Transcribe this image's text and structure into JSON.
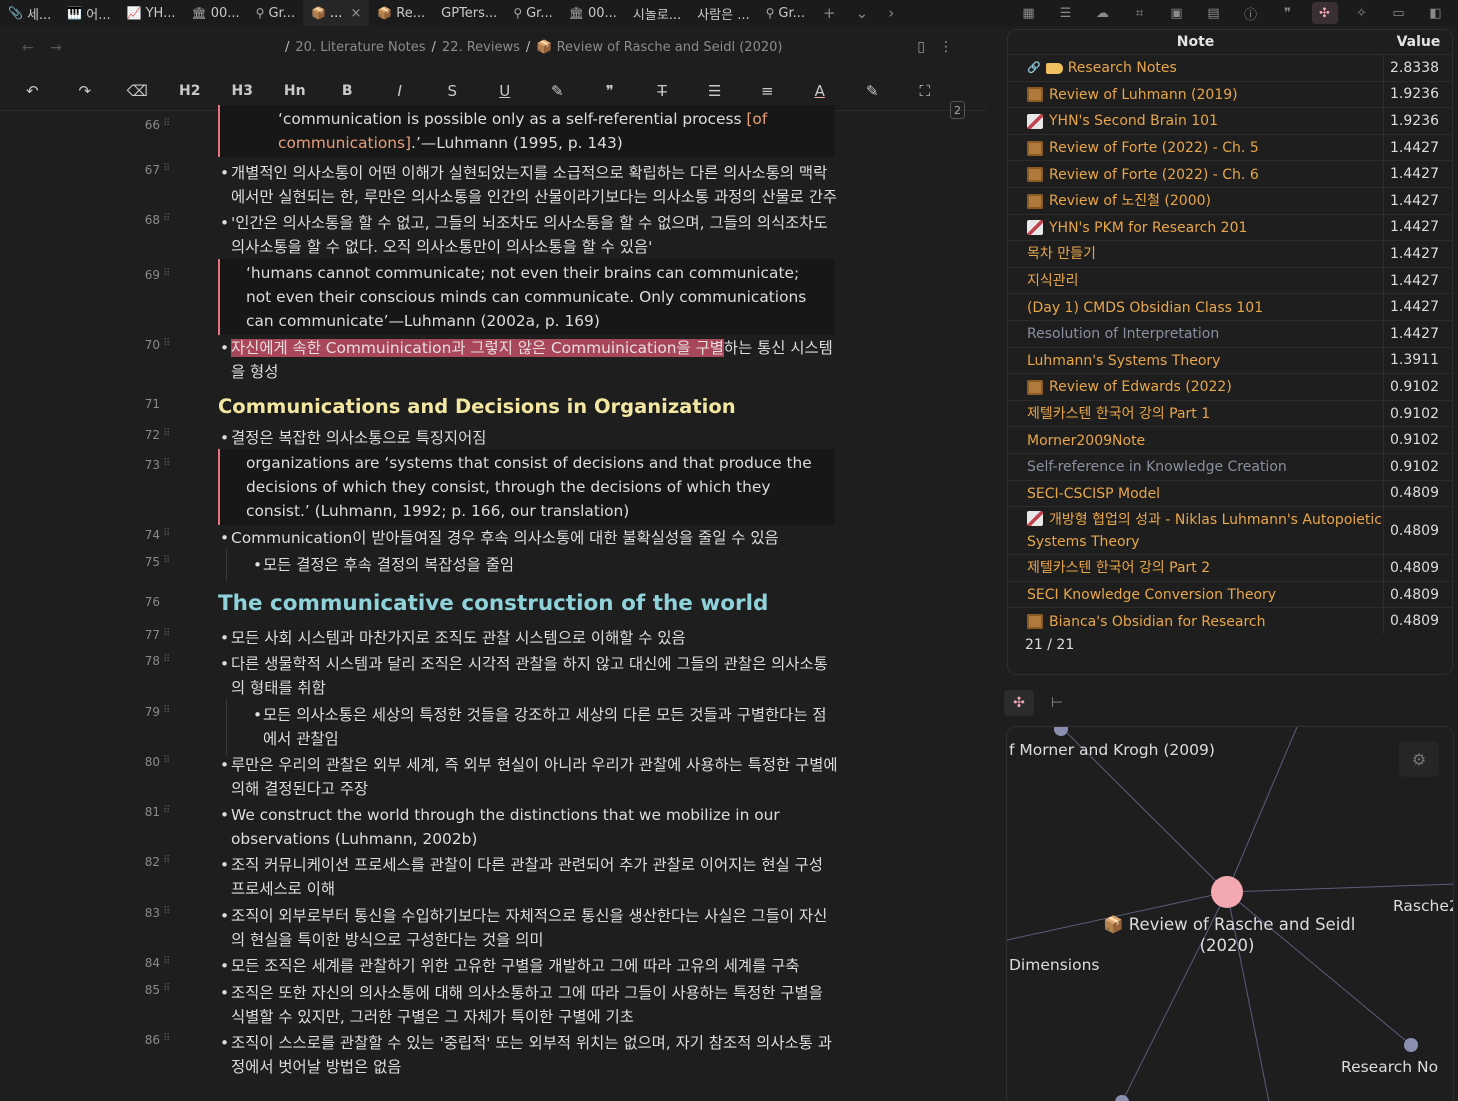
{
  "tabs": [
    {
      "icon": "📎",
      "label": "세..."
    },
    {
      "icon": "🎹",
      "label": "어..."
    },
    {
      "icon": "📈",
      "label": "YH..."
    },
    {
      "icon": "🏛",
      "label": "00..."
    },
    {
      "icon": "⚲",
      "label": "Gr..."
    },
    {
      "icon": "📦",
      "label": "...",
      "active": true,
      "close": "×"
    },
    {
      "icon": "📦",
      "label": "Re..."
    },
    {
      "icon": "",
      "label": "GPTers..."
    },
    {
      "icon": "⚲",
      "label": "Gr..."
    },
    {
      "icon": "🏛",
      "label": "00..."
    },
    {
      "icon": "",
      "label": "시놀로..."
    },
    {
      "icon": "",
      "label": "사람은 ..."
    },
    {
      "icon": "⚲",
      "label": "Gr..."
    }
  ],
  "tab_controls": {
    "add": "+",
    "more": "⌄",
    "collapse": "›"
  },
  "breadcrumb": {
    "parts": [
      "20. Literature Notes",
      "22. Reviews",
      "📦 Review of Rasche and Seidl (2020)"
    ],
    "lead": "/",
    "sep": "/"
  },
  "toolbar": {
    "buttons": [
      "↶",
      "↷",
      "⌫",
      "H2",
      "H3",
      "Hn",
      "B",
      "I",
      "S",
      "U",
      "✎",
      "❞",
      "T̶",
      "☰",
      "≡",
      "A",
      "✎",
      "⛶"
    ],
    "count": "2"
  },
  "editor_lines": [
    {
      "num": "66",
      "kind": "quote",
      "text": "‘communication is possible only as a self-referential process ",
      "link": "[of communications]",
      "tail": ".’—Luhmann (1995, p. 143)"
    },
    {
      "num": "67",
      "kind": "bullet",
      "text": "개별적인 의사소통이 어떤 이해가 실현되었는지를 소급적으로 확립하는 다른 의사소통의 맥락에서만 실현되는 한, 루만은 의사소통을 인간의 산물이라기보다는 의사소통 과정의 산물로 간주"
    },
    {
      "num": "68",
      "kind": "bullet",
      "text": "'인간은 의사소통을 할 수 없고, 그들의 뇌조차도 의사소통을 할 수 없으며, 그들의 의식조차도 의사소통을 할 수 없다. 오직 의사소통만이 의사소통을 할 수 있음'"
    },
    {
      "num": "69",
      "kind": "quote",
      "text": "‘humans cannot communicate; not even their brains can communicate; not even their conscious minds can communicate. Only communications can communicate’—Luhmann (2002a, p. 169)"
    },
    {
      "num": "70",
      "kind": "bullet-hl",
      "hl": "자신에게 속한 Commuinication과 그렇지 않은 Commuinication을 구별",
      "text": "하는 통신 시스템을 형성"
    },
    {
      "num": "71",
      "kind": "h2",
      "text": "Communications and Decisions in Organization"
    },
    {
      "num": "72",
      "kind": "bullet",
      "text": "결정은 복잡한 의사소통으로 특징지어짐"
    },
    {
      "num": "73",
      "kind": "quote",
      "text": "organizations are ‘systems that consist of decisions and that produce the decisions of which they consist, through the decisions of which they consist.’ (Luhmann, 1992; p. 166, our translation)"
    },
    {
      "num": "74",
      "kind": "bullet",
      "text": "Communication이 받아들여질 경우 후속 의사소통에 대한 불확실성을 줄일 수 있음"
    },
    {
      "num": "75",
      "kind": "bullet2",
      "text": "모든 결정은 후속 결정의 복잡성을 줄임"
    },
    {
      "num": "76",
      "kind": "h1",
      "text": "The communicative construction of the world"
    },
    {
      "num": "77",
      "kind": "bullet",
      "text": "모든 사회 시스템과 마찬가지로 조직도 관찰 시스템으로 이해할 수 있음"
    },
    {
      "num": "78",
      "kind": "bullet",
      "text": "다른 생물학적 시스템과 달리 조직은 시각적 관찰을 하지 않고 대신에 그들의 관찰은 의사소통의 형태를 취함"
    },
    {
      "num": "79",
      "kind": "bullet2",
      "text": "모든 의사소통은 세상의 특정한 것들을 강조하고 세상의 다른 모든 것들과 구별한다는 점에서 관찰임"
    },
    {
      "num": "80",
      "kind": "bullet",
      "text": "루만은 우리의 관찰은 외부 세계, 즉 외부 현실이 아니라 우리가 관찰에 사용하는 특정한 구별에 의해 결정된다고 주장"
    },
    {
      "num": "81",
      "kind": "bullet",
      "text": "We construct the world through the distinctions that we mobilize in our observations (Luhmann, 2002b)"
    },
    {
      "num": "82",
      "kind": "bullet",
      "text": "조직 커뮤니케이션 프로세스를 관찰이 다른 관찰과 관련되어 추가 관찰로 이어지는 현실 구성 프로세스로 이해"
    },
    {
      "num": "83",
      "kind": "bullet",
      "text": "조직이 외부로부터 통신을 수입하기보다는 자체적으로 통신을 생산한다는 사실은 그들이 자신의 현실을 특이한 방식으로 구성한다는 것을 의미"
    },
    {
      "num": "84",
      "kind": "bullet",
      "text": "모든 조직은 세계를 관찰하기 위한 고유한 구별을 개발하고 그에 따라 고유의 세계를 구축"
    },
    {
      "num": "85",
      "kind": "bullet",
      "text": "조직은 또한 자신의 의사소통에 대해 의사소통하고 그에 따라 그들이 사용하는 특정한 구별을 식별할 수 있지만, 그러한 구별은 그 자체가 특이한 구별에 기초"
    },
    {
      "num": "86",
      "kind": "bullet",
      "text": "조직이 스스로를 관찰할 수 있는 '중립적' 또는 외부적 위치는 없으며, 자기 참조적 의사소통 과정에서 벗어날 방법은 없음"
    }
  ],
  "table": {
    "headers": [
      "Note",
      "Value"
    ],
    "rows": [
      {
        "icon": "link-tag",
        "note": "Research Notes",
        "value": "2.8338"
      },
      {
        "icon": "pkg",
        "note": "Review of Luhmann (2019)",
        "value": "1.9236"
      },
      {
        "icon": "pen",
        "note": "YHN's Second Brain 101",
        "value": "1.9236"
      },
      {
        "icon": "pkg",
        "note": "Review of Forte (2022) - Ch. 5",
        "value": "1.4427"
      },
      {
        "icon": "pkg",
        "note": "Review of Forte (2022) - Ch. 6",
        "value": "1.4427"
      },
      {
        "icon": "pkg",
        "note": "Review of 노진철 (2000)",
        "value": "1.4427"
      },
      {
        "icon": "pen",
        "note": "YHN's PKM for Research 201",
        "value": "1.4427"
      },
      {
        "icon": "",
        "note": "목차 만들기",
        "value": "1.4427"
      },
      {
        "icon": "",
        "note": "지식관리",
        "value": "1.4427"
      },
      {
        "icon": "",
        "note": "(Day 1) CMDS Obsidian Class 101",
        "value": "1.4427"
      },
      {
        "icon": "",
        "note": "Resolution of Interpretation",
        "value": "1.4427",
        "muted": true
      },
      {
        "icon": "",
        "note": "Luhmann's Systems Theory",
        "value": "1.3911"
      },
      {
        "icon": "pkg",
        "note": "Review of Edwards (2022)",
        "value": "0.9102"
      },
      {
        "icon": "",
        "note": "제텔카스텐 한국어 강의 Part 1",
        "value": "0.9102"
      },
      {
        "icon": "",
        "note": "Morner2009Note",
        "value": "0.9102"
      },
      {
        "icon": "",
        "note": "Self-reference in Knowledge Creation",
        "value": "0.9102",
        "muted": true
      },
      {
        "icon": "",
        "note": "SECI-CSCISP Model",
        "value": "0.4809"
      },
      {
        "icon": "pen",
        "note": "개방형 협업의 성과 - Niklas Luhmann's Autopoietic Systems Theory",
        "value": "0.4809",
        "two": true
      },
      {
        "icon": "",
        "note": "제텔카스텐 한국어 강의 Part 2",
        "value": "0.4809"
      },
      {
        "icon": "",
        "note": "SECI Knowledge Conversion Theory",
        "value": "0.4809"
      },
      {
        "icon": "pkg",
        "note": "Bianca's Obsidian for Research",
        "value": "0.4809"
      }
    ],
    "footer": "21 / 21"
  },
  "graph": {
    "center_label_line1": "📦 Review of Rasche and Seidl",
    "center_label_line2": "(2020)",
    "labels": [
      "f Morner and Krogh (2009)",
      "Rasche2",
      "Dimensions",
      "Research No"
    ],
    "colors": {
      "center": "#f4a9b1",
      "node": "#8a8fb0",
      "edge": "#5a5f7a"
    }
  },
  "colors": {
    "accent": "#f4a9b1",
    "link": "#e8a64a",
    "h1": "#8fd2da",
    "h2": "#f2e6a0",
    "highlight": "#a8465a",
    "quote_border": "#e8727e"
  }
}
